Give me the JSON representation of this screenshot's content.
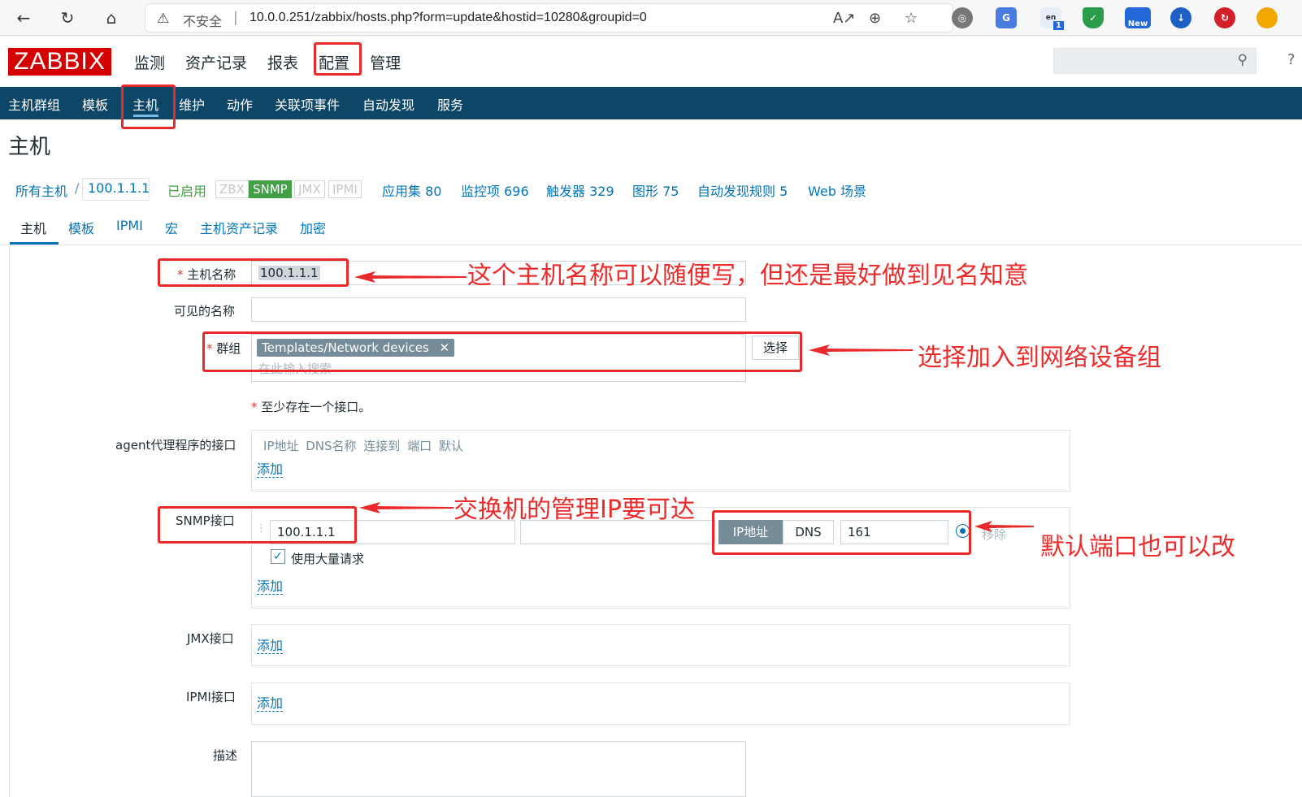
{
  "browser": {
    "insecure_label": "不安全",
    "separator": "|",
    "url": "10.0.0.251/zabbix/hosts.php?form=update&hostid=10280&groupid=0",
    "ext_new_label": "New",
    "ext_badge": "1"
  },
  "header": {
    "logo": "ZABBIX",
    "menu": [
      "监测",
      "资产记录",
      "报表",
      "配置",
      "管理"
    ]
  },
  "subnav": [
    "主机群组",
    "模板",
    "主机",
    "维护",
    "动作",
    "关联项事件",
    "自动发现",
    "服务"
  ],
  "page_title": "主机",
  "crumbs": {
    "all_hosts": "所有主机",
    "slash": "/",
    "host": "100.1.1.1",
    "status": "已启用",
    "availability": [
      "ZBX",
      "SNMP",
      "JMX",
      "IPMI"
    ],
    "links": [
      "应用集 80",
      "监控项 696",
      "触发器 329",
      "图形 75",
      "自动发现规则 5",
      "Web 场景"
    ]
  },
  "tabs": [
    "主机",
    "模板",
    "IPMI",
    "宏",
    "主机资产记录",
    "加密"
  ],
  "form": {
    "host_name_label": "主机名称",
    "host_name_value": "100.1.1.1",
    "visible_name_label": "可见的名称",
    "visible_name_value": "",
    "groups_label": "群组",
    "group_tag": "Templates/Network devices",
    "group_tag_remove": "✕",
    "groups_placeholder": "在此输入搜索",
    "select_button": "选择",
    "required_star": "*",
    "interface_note": "至少存在一个接口。",
    "agent_label": "agent代理程序的接口",
    "iface_header": "IP地址 DNS名称 连接到 端口 默认",
    "add_link": "添加",
    "snmp_label": "SNMP接口",
    "snmp_ip": "100.1.1.1",
    "snmp_dns": "",
    "connect_ip": "IP地址",
    "connect_dns": "DNS",
    "port": "161",
    "remove": "移除",
    "bulk_label": "使用大量请求",
    "jmx_label": "JMX接口",
    "ipmi_label": "IPMI接口",
    "description_label": "描述"
  },
  "annotations": {
    "host_name_note": "这个主机名称可以随便写，但还是最好做到见名知意",
    "group_note": "选择加入到网络设备组",
    "snmp_note": "交换机的管理IP要可达",
    "port_note": "默认端口也可以改"
  },
  "colors": {
    "zabbix_red": "#d40000",
    "nav_blue": "#0e4668",
    "link_blue": "#0275b8",
    "annotation_red": "#ea2a2a",
    "enabled_green": "#429e47"
  }
}
